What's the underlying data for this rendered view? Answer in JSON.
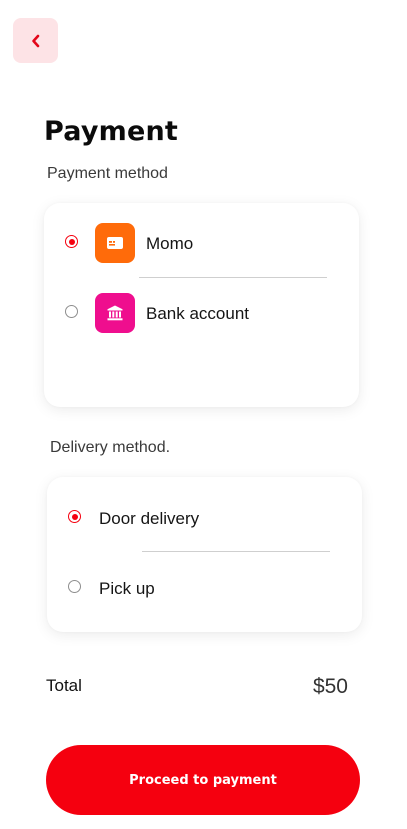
{
  "header": {
    "back_icon": "chevron-left-icon",
    "title": "Payment"
  },
  "payment": {
    "section_label": "Payment method",
    "options": [
      {
        "label": "Momo",
        "selected": true,
        "icon": "card-icon",
        "icon_color": "#ff6b0a"
      },
      {
        "label": "Bank account",
        "selected": false,
        "icon": "bank-icon",
        "icon_color": "#ef0e8e"
      }
    ]
  },
  "delivery": {
    "section_label": "Delivery method.",
    "options": [
      {
        "label": "Door delivery",
        "selected": true
      },
      {
        "label": "Pick up",
        "selected": false
      }
    ]
  },
  "summary": {
    "total_label": "Total",
    "total_value": "$50"
  },
  "actions": {
    "proceed_label": "Proceed to payment"
  },
  "colors": {
    "accent": "#f5000f",
    "back_button_bg": "#fde3e6"
  }
}
